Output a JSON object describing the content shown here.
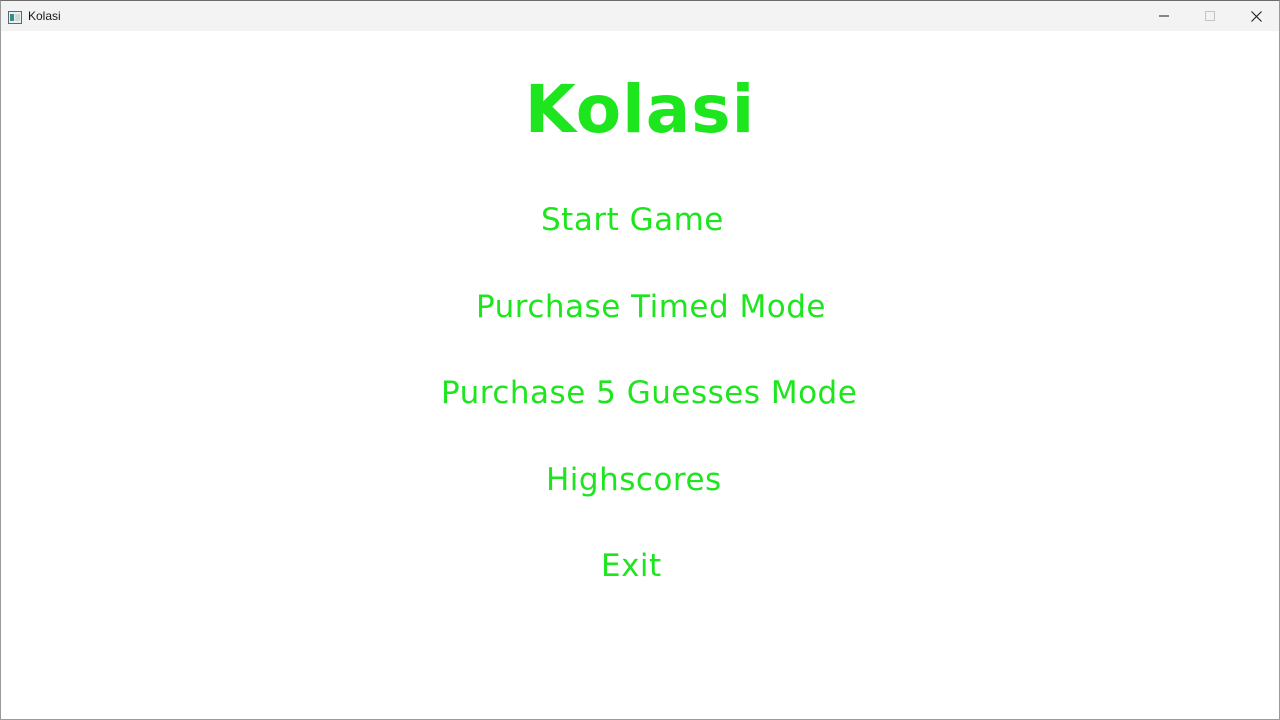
{
  "window": {
    "title": "Kolasi",
    "icons": {
      "app": "app-window-icon",
      "minimize": "minimize-icon",
      "maximize": "maximize-icon",
      "close": "close-icon"
    }
  },
  "menu": {
    "title": "Kolasi",
    "items": [
      {
        "label": "Start Game"
      },
      {
        "label": "Purchase Timed Mode"
      },
      {
        "label": "Purchase 5 Guesses Mode"
      },
      {
        "label": "Highscores"
      },
      {
        "label": "Exit"
      }
    ]
  },
  "colors": {
    "accent": "#1ee61e",
    "background": "#ffffff",
    "titlebar": "#f3f3f3"
  }
}
